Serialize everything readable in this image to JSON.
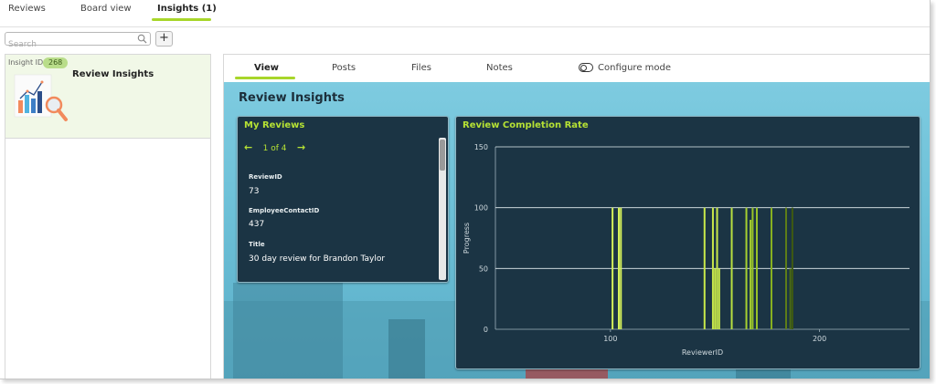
{
  "top_tabs": [
    {
      "label": "Reviews"
    },
    {
      "label": "Board view"
    },
    {
      "label": "Insights (1)"
    }
  ],
  "search": {
    "placeholder": "Search"
  },
  "add_button": "+",
  "insight_card": {
    "id_label": "Insight ID",
    "id_value": "268",
    "title": "Review Insights"
  },
  "sub_tabs": [
    {
      "label": "View"
    },
    {
      "label": "Posts"
    },
    {
      "label": "Files"
    },
    {
      "label": "Notes"
    }
  ],
  "configure_mode_label": "Configure mode",
  "dashboard": {
    "title": "Review Insights",
    "my_reviews": {
      "title": "My Reviews",
      "pager": "1 of 4",
      "fields": [
        {
          "label": "ReviewID",
          "value": "73"
        },
        {
          "label": "EmployeeContactID",
          "value": "437"
        },
        {
          "label": "Title",
          "value": "30 day review for Brandon Taylor"
        }
      ]
    }
  },
  "colors": {
    "accent_green": "#b6e234",
    "panel_dark": "#1b3444",
    "tab_underline": "#a8d62a"
  },
  "chart_data": {
    "type": "bar",
    "title": "Review Completion Rate",
    "xlabel": "ReviewerID",
    "ylabel": "Progress",
    "xlim": [
      45,
      243
    ],
    "ylim": [
      0,
      150
    ],
    "xticks": [
      100,
      200
    ],
    "yticks": [
      0,
      50,
      100,
      150
    ],
    "grid": true,
    "bars": [
      {
        "x": 101,
        "y": 100,
        "color": "#d4f05a"
      },
      {
        "x": 104,
        "y": 100,
        "color": "#d4f05a"
      },
      {
        "x": 105,
        "y": 100,
        "color": "#d4f05a"
      },
      {
        "x": 145,
        "y": 100,
        "color": "#c8e84a"
      },
      {
        "x": 149,
        "y": 100,
        "color": "#c8e84a"
      },
      {
        "x": 150,
        "y": 50,
        "color": "#c8e84a"
      },
      {
        "x": 151,
        "y": 100,
        "color": "#c8e84a"
      },
      {
        "x": 152,
        "y": 50,
        "color": "#c8e84a"
      },
      {
        "x": 158,
        "y": 100,
        "color": "#b8e040"
      },
      {
        "x": 165,
        "y": 100,
        "color": "#a6d030"
      },
      {
        "x": 167,
        "y": 90,
        "color": "#a6d030"
      },
      {
        "x": 168,
        "y": 100,
        "color": "#98c428"
      },
      {
        "x": 170,
        "y": 100,
        "color": "#98c428"
      },
      {
        "x": 177,
        "y": 100,
        "color": "#86b020"
      },
      {
        "x": 184,
        "y": 100,
        "color": "#5e7e18"
      },
      {
        "x": 186,
        "y": 50,
        "color": "#4a6a14"
      },
      {
        "x": 187,
        "y": 100,
        "color": "#3e5a10"
      }
    ]
  }
}
